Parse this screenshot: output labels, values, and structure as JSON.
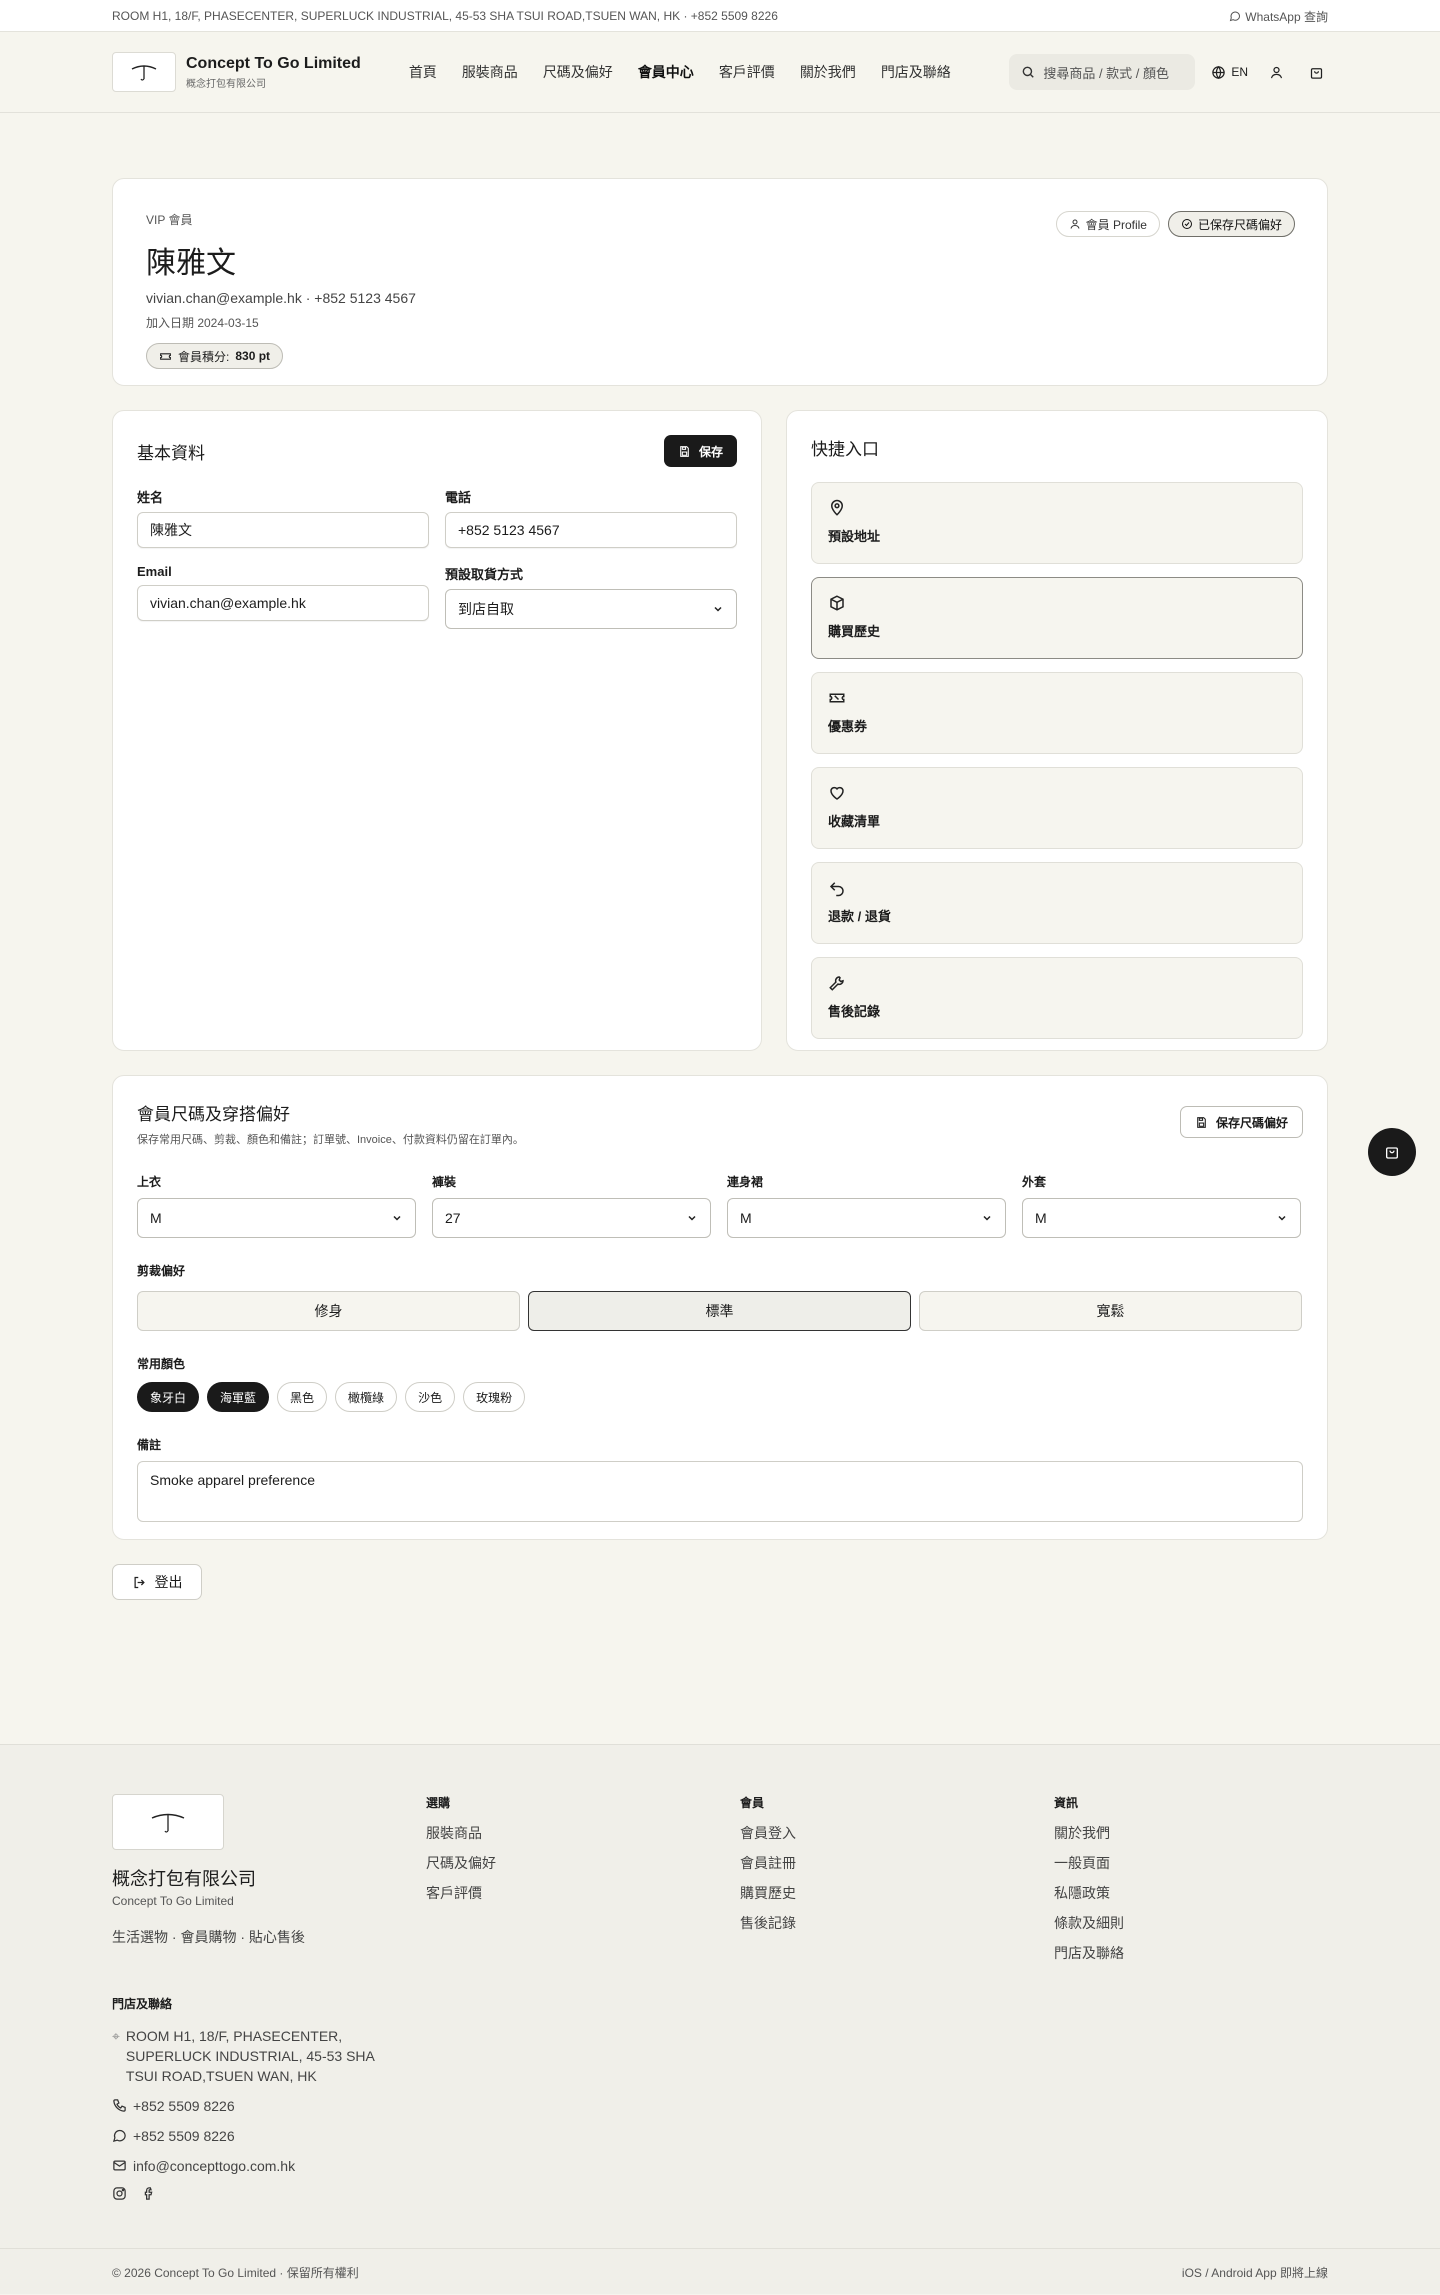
{
  "topbar": {
    "address": "ROOM H1, 18/F, PHASECENTER, SUPERLUCK INDUSTRIAL, 45-53 SHA TSUI ROAD,TSUEN WAN, HK · +852 5509 8226",
    "whatsapp": "WhatsApp 查詢"
  },
  "header": {
    "brand_en": "Concept To Go Limited",
    "brand_zh": "概念打包有限公司",
    "nav": [
      "首頁",
      "服裝商品",
      "尺碼及偏好",
      "會員中心",
      "客戶評價",
      "關於我們",
      "門店及聯絡"
    ],
    "active_nav": "會員中心",
    "search_placeholder": "搜尋商品 / 款式 / 顏色",
    "lang": "EN"
  },
  "profile": {
    "tier": "VIP 會員",
    "name": "陳雅文",
    "contact": "vivian.chan@example.hk · +852 5123 4567",
    "joined": "加入日期 2024-03-15",
    "points_label": "會員積分:",
    "points_value": "830 pt",
    "profile_btn": "會員 Profile",
    "saved_btn": "已保存尺碼偏好"
  },
  "basic": {
    "title": "基本資料",
    "save": "保存",
    "name_label": "姓名",
    "name_value": "陳雅文",
    "phone_label": "電話",
    "phone_value": "+852 5123 4567",
    "email_label": "Email",
    "email_value": "vivian.chan@example.hk",
    "pickup_label": "預設取貨方式",
    "pickup_value": "到店自取"
  },
  "quick": {
    "title": "快捷入口",
    "items": [
      {
        "label": "預設地址",
        "icon": "map-pin-icon"
      },
      {
        "label": "購買歷史",
        "icon": "package-icon"
      },
      {
        "label": "優惠券",
        "icon": "ticket-icon"
      },
      {
        "label": "收藏清單",
        "icon": "heart-icon"
      },
      {
        "label": "退款 / 退貨",
        "icon": "undo-icon"
      },
      {
        "label": "售後記錄",
        "icon": "wrench-icon"
      }
    ]
  },
  "size": {
    "title": "會員尺碼及穿搭偏好",
    "subtitle": "保存常用尺碼、剪裁、顏色和備註；訂單號、Invoice、付款資料仍留在訂單內。",
    "save": "保存尺碼偏好",
    "fields": [
      {
        "label": "上衣",
        "value": "M"
      },
      {
        "label": "褲裝",
        "value": "27"
      },
      {
        "label": "連身裙",
        "value": "M"
      },
      {
        "label": "外套",
        "value": "M"
      }
    ],
    "fit_label": "剪裁偏好",
    "fits": [
      "修身",
      "標準",
      "寬鬆"
    ],
    "fit_selected": "標準",
    "colors_label": "常用顏色",
    "colors": [
      {
        "name": "象牙白",
        "on": true
      },
      {
        "name": "海軍藍",
        "on": true
      },
      {
        "name": "黑色",
        "on": false
      },
      {
        "name": "橄欖綠",
        "on": false
      },
      {
        "name": "沙色",
        "on": false
      },
      {
        "name": "玫瑰粉",
        "on": false
      }
    ],
    "notes_label": "備註",
    "notes_value": "Smoke apparel preference"
  },
  "logout": "登出",
  "footer": {
    "name_zh": "概念打包有限公司",
    "name_en": "Concept To Go Limited",
    "tagline": "生活選物 · 會員購物 · 貼心售後",
    "cols": [
      {
        "title": "選購",
        "links": [
          "服裝商品",
          "尺碼及偏好",
          "客戶評價"
        ]
      },
      {
        "title": "會員",
        "links": [
          "會員登入",
          "會員註冊",
          "購買歷史",
          "售後記錄"
        ]
      },
      {
        "title": "資訊",
        "links": [
          "關於我們",
          "一般頁面",
          "私隱政策",
          "條款及細則",
          "門店及聯絡"
        ]
      }
    ],
    "contact_title": "門店及聯絡",
    "address": "ROOM H1, 18/F, PHASECENTER, SUPERLUCK INDUSTRIAL, 45-53 SHA TSUI ROAD,TSUEN WAN, HK",
    "phone": "+852 5509 8226",
    "whatsapp": "+852 5509 8226",
    "email": "info@concepttogo.com.hk",
    "copyright": "© 2026 Concept To Go Limited · 保留所有權利",
    "app_note": "iOS / Android App 即將上線"
  }
}
